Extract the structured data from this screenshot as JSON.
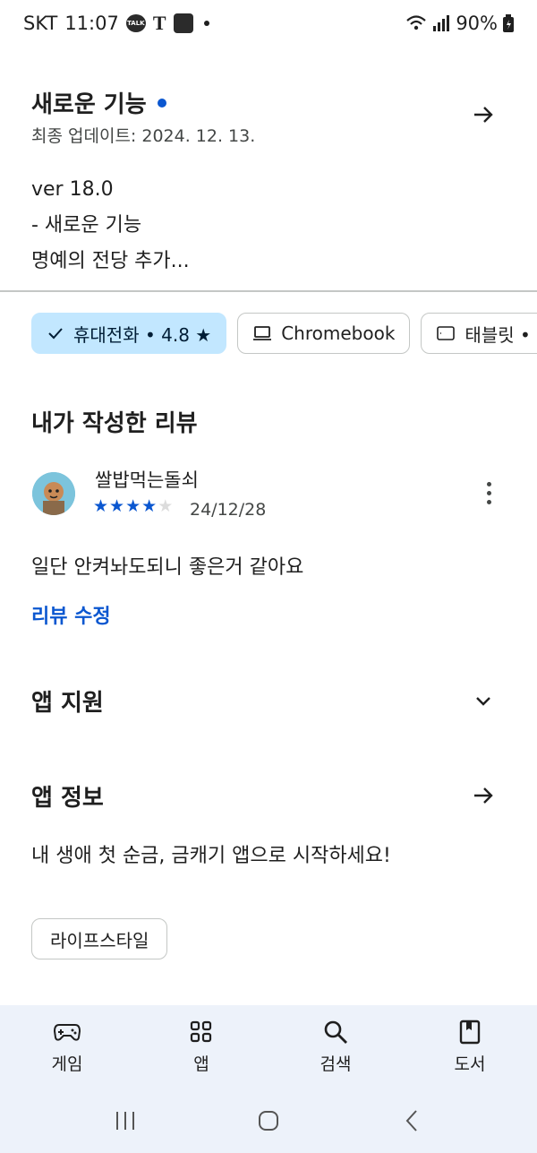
{
  "status_bar": {
    "carrier": "SKT",
    "time": "11:07",
    "talk_badge": "TALK",
    "t_badge": "T",
    "battery": "90%"
  },
  "whats_new": {
    "title": "새로운 기능",
    "updated": "최종 업데이트: 2024. 12. 13.",
    "notes": [
      "ver 18.0",
      "- 새로운 기능",
      "명예의 전당 추가..."
    ]
  },
  "device_chips": [
    {
      "label": "휴대전화 • 4.8 ★",
      "selected": true,
      "icon": "check-icon"
    },
    {
      "label": "Chromebook",
      "selected": false,
      "icon": "laptop-icon"
    },
    {
      "label": "태블릿 •",
      "selected": false,
      "icon": "tablet-icon"
    }
  ],
  "my_review": {
    "heading": "내가 작성한 리뷰",
    "reviewer": "쌀밥먹는돌쇠",
    "rating": 4,
    "rating_max": 5,
    "date": "24/12/28",
    "text": "일단 안켜놔도되니 좋은거 같아요",
    "edit_label": "리뷰 수정"
  },
  "app_support": {
    "title": "앱 지원"
  },
  "app_info": {
    "title": "앱 정보",
    "description": "내 생애 첫 순금, 금캐기 앱으로 시작하세요!",
    "category": "라이프스타일"
  },
  "bottom_nav": [
    {
      "label": "게임",
      "icon": "gamepad-icon"
    },
    {
      "label": "앱",
      "icon": "apps-grid-icon"
    },
    {
      "label": "검색",
      "icon": "search-icon"
    },
    {
      "label": "도서",
      "icon": "book-icon"
    }
  ],
  "colors": {
    "accent": "#0b57d0",
    "chip_selected_bg": "#c2e7ff",
    "nav_bg": "#edf2fa"
  }
}
